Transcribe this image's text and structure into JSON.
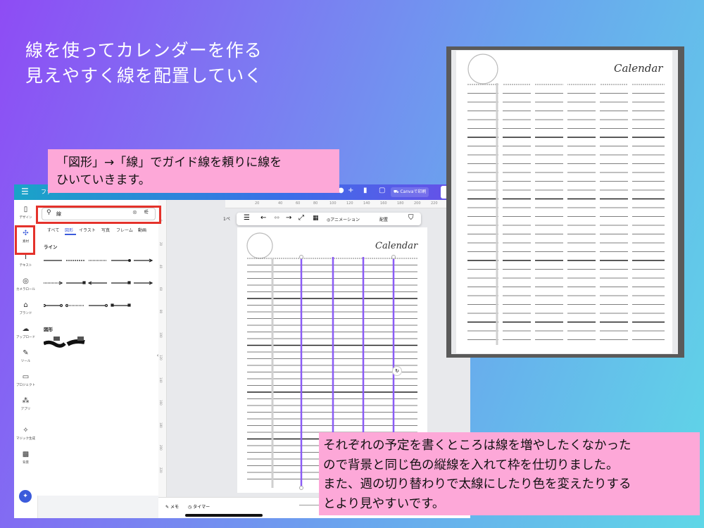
{
  "headline": {
    "line1": "線を使ってカレンダーを作る",
    "line2": "見えやすく線を配置していく"
  },
  "callout_top": {
    "line1": "「図形」→「線」でガイド線を頼りに線を",
    "line2": "ひいていきます。"
  },
  "callout_bottom": {
    "line1": "それぞれの予定を書くところは線を増やしたくなかった",
    "line2": "ので背景と同じ色の縦線を入れて枠を仕切りました。",
    "line3": "また、週の切り替わりで太線にしたり色を変えたりする",
    "line4": "とより見やすいです。"
  },
  "app": {
    "file_label": "ファ",
    "print_label": "Canvaで印刷",
    "rail": [
      {
        "icon": "design-icon",
        "glyph": "▯",
        "label": "デザイン"
      },
      {
        "icon": "elements-icon",
        "glyph": "✣",
        "label": "素材"
      },
      {
        "icon": "text-icon",
        "glyph": "T",
        "label": "テキスト"
      },
      {
        "icon": "camera-roll-icon",
        "glyph": "◎",
        "label": "カメラロール"
      },
      {
        "icon": "brand-icon",
        "glyph": "⌂",
        "label": "ブランド"
      },
      {
        "icon": "upload-icon",
        "glyph": "☁",
        "label": "アップロード"
      },
      {
        "icon": "tools-icon",
        "glyph": "✎",
        "label": "ツール"
      },
      {
        "icon": "projects-icon",
        "glyph": "▭",
        "label": "プロジェクト"
      },
      {
        "icon": "apps-icon",
        "glyph": "⁂",
        "label": "アプリ"
      },
      {
        "icon": "magic-icon",
        "glyph": "✧",
        "label": "マジック生成"
      },
      {
        "icon": "background-icon",
        "glyph": "▩",
        "label": "背景"
      }
    ],
    "search": {
      "value": "線"
    },
    "tabs": [
      "すべて",
      "図形",
      "イラスト",
      "写真",
      "フレーム",
      "動画"
    ],
    "section_lines": "ライン",
    "section_shapes": "図形",
    "ruler_top": [
      "20",
      "40",
      "60",
      "80",
      "100",
      "120",
      "140",
      "160",
      "180",
      "200",
      "220"
    ],
    "ruler_left": [
      "0",
      "20",
      "40",
      "60",
      "80",
      "100",
      "120",
      "140",
      "160",
      "180",
      "200",
      "220",
      "240",
      "260",
      "280"
    ],
    "toolbar": {
      "page": "1ペ",
      "animation": "アニメーション",
      "arrange": "配置"
    },
    "bottom": {
      "memo": "メモ",
      "timer": "タイマー"
    },
    "calendar_title": "Calendar"
  },
  "preview": {
    "calendar_title": "Calendar"
  },
  "colors": {
    "accent_red": "#e4322b",
    "callout_pink": "#fda8d8",
    "guide_purple": "#8b5cf6"
  }
}
